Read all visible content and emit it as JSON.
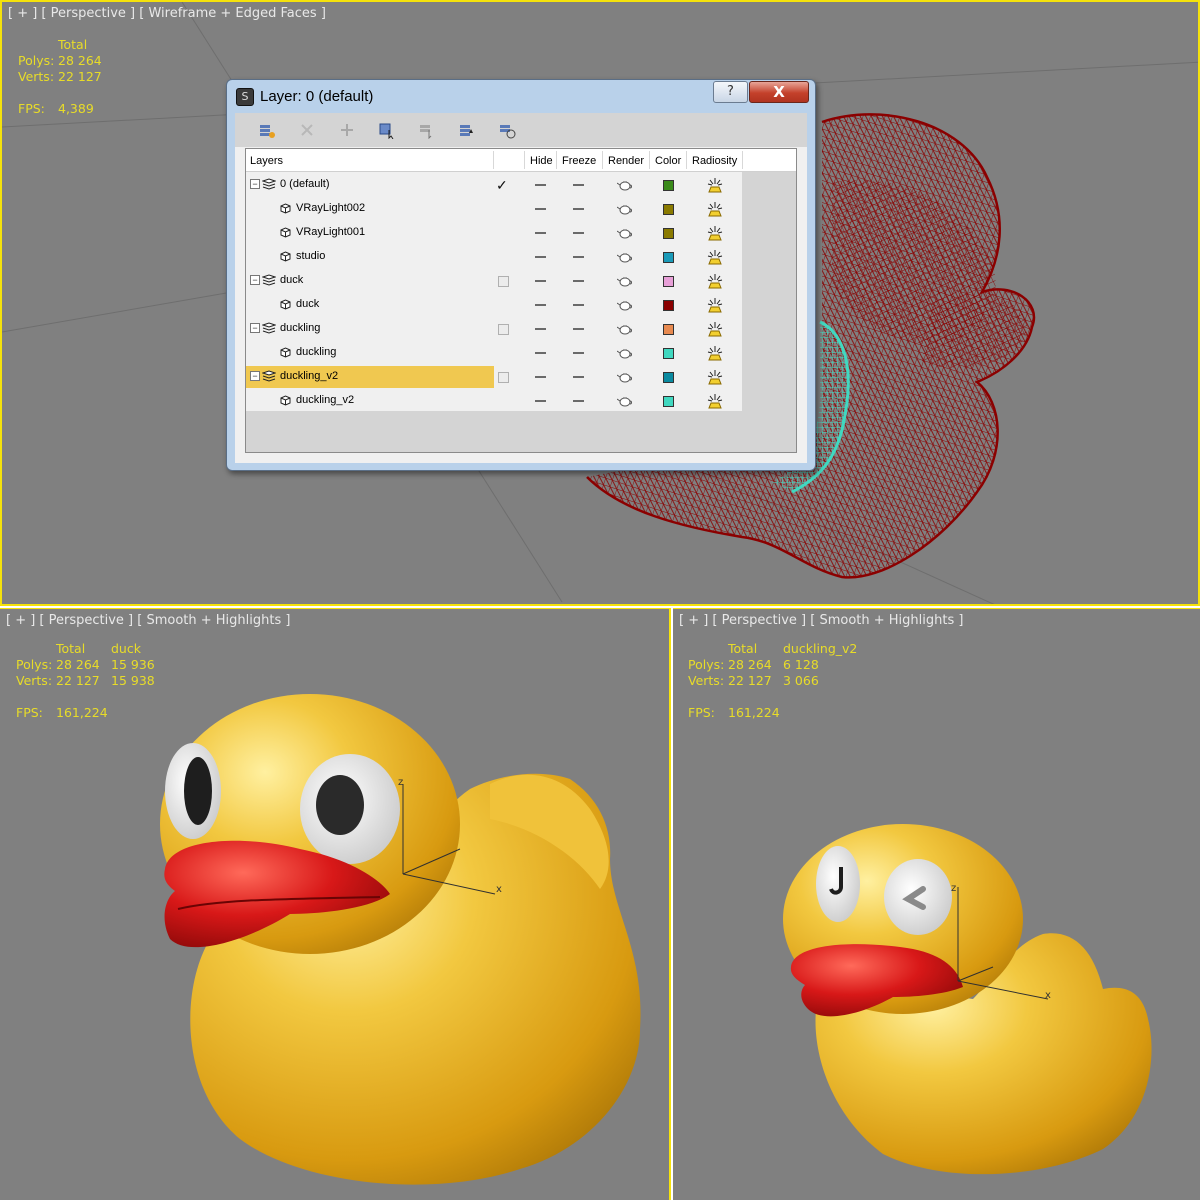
{
  "viewports": {
    "top": {
      "label": "[ + ] [ Perspective ] [ Wireframe + Edged Faces ]",
      "stats": {
        "total_header": "Total",
        "polys_label": "Polys:",
        "polys_total": "28 264",
        "verts_label": "Verts:",
        "verts_total": "22 127",
        "fps_label": "FPS:",
        "fps_value": "4,389"
      }
    },
    "bottom_left": {
      "label": "[ + ] [ Perspective ] [ Smooth + Highlights ]",
      "stats": {
        "total_header": "Total",
        "object_header": "duck",
        "polys_label": "Polys:",
        "polys_total": "28 264",
        "polys_object": "15 936",
        "verts_label": "Verts:",
        "verts_total": "22 127",
        "verts_object": "15 938",
        "fps_label": "FPS:",
        "fps_value": "161,224"
      },
      "axis": {
        "z": "z",
        "x": "x"
      }
    },
    "bottom_right": {
      "label": "[ + ] [ Perspective ] [ Smooth + Highlights ]",
      "stats": {
        "total_header": "Total",
        "object_header": "duckling_v2",
        "polys_label": "Polys:",
        "polys_total": "28 264",
        "polys_object": "6 128",
        "verts_label": "Verts:",
        "verts_total": "22 127",
        "verts_object": "3 066",
        "fps_label": "FPS:",
        "fps_value": "161,224"
      },
      "axis": {
        "z": "z",
        "x": "x"
      }
    }
  },
  "dialog": {
    "title": "Layer: 0 (default)",
    "help_label": "?",
    "close_label": "X",
    "toolbar_icons": [
      "create-layer-icon",
      "delete-layer-icon",
      "add-to-layer-icon",
      "select-objects-icon",
      "select-layer-icon",
      "set-current-layer-icon",
      "hide-freeze-all-icon"
    ],
    "columns": {
      "layers": "Layers",
      "hide": "Hide",
      "freeze": "Freeze",
      "render": "Render",
      "color": "Color",
      "radiosity": "Radiosity"
    },
    "rows": [
      {
        "name": "0 (default)",
        "type": "layer",
        "expander": "−",
        "current": true,
        "color": "#3a8a1a"
      },
      {
        "name": "VRayLight002",
        "type": "object",
        "color": "#8a7a00"
      },
      {
        "name": "VRayLight001",
        "type": "object",
        "color": "#8a7a00"
      },
      {
        "name": "studio",
        "type": "object",
        "color": "#1a9ab8"
      },
      {
        "name": "duck",
        "type": "layer",
        "expander": "−",
        "current": false,
        "color": "#e8a0d8"
      },
      {
        "name": "duck",
        "type": "object",
        "color": "#8a0000"
      },
      {
        "name": "duckling",
        "type": "layer",
        "expander": "−",
        "current": false,
        "color": "#e88a50"
      },
      {
        "name": "duckling",
        "type": "object",
        "color": "#40d8c0"
      },
      {
        "name": "duckling_v2",
        "type": "layer",
        "expander": "−",
        "current": false,
        "selected": true,
        "color": "#0a8aa0"
      },
      {
        "name": "duckling_v2",
        "type": "object",
        "color": "#40d8c0"
      }
    ],
    "checkmark": "✓"
  },
  "colors": {
    "viewport_bg": "#808080",
    "active_border": "#f5e20b",
    "stats_text": "#e8dc28",
    "wire": "#8b0000",
    "duck_yellow": "#f2c23a",
    "beak_red": "#c81414",
    "selection": "#f0c850"
  }
}
